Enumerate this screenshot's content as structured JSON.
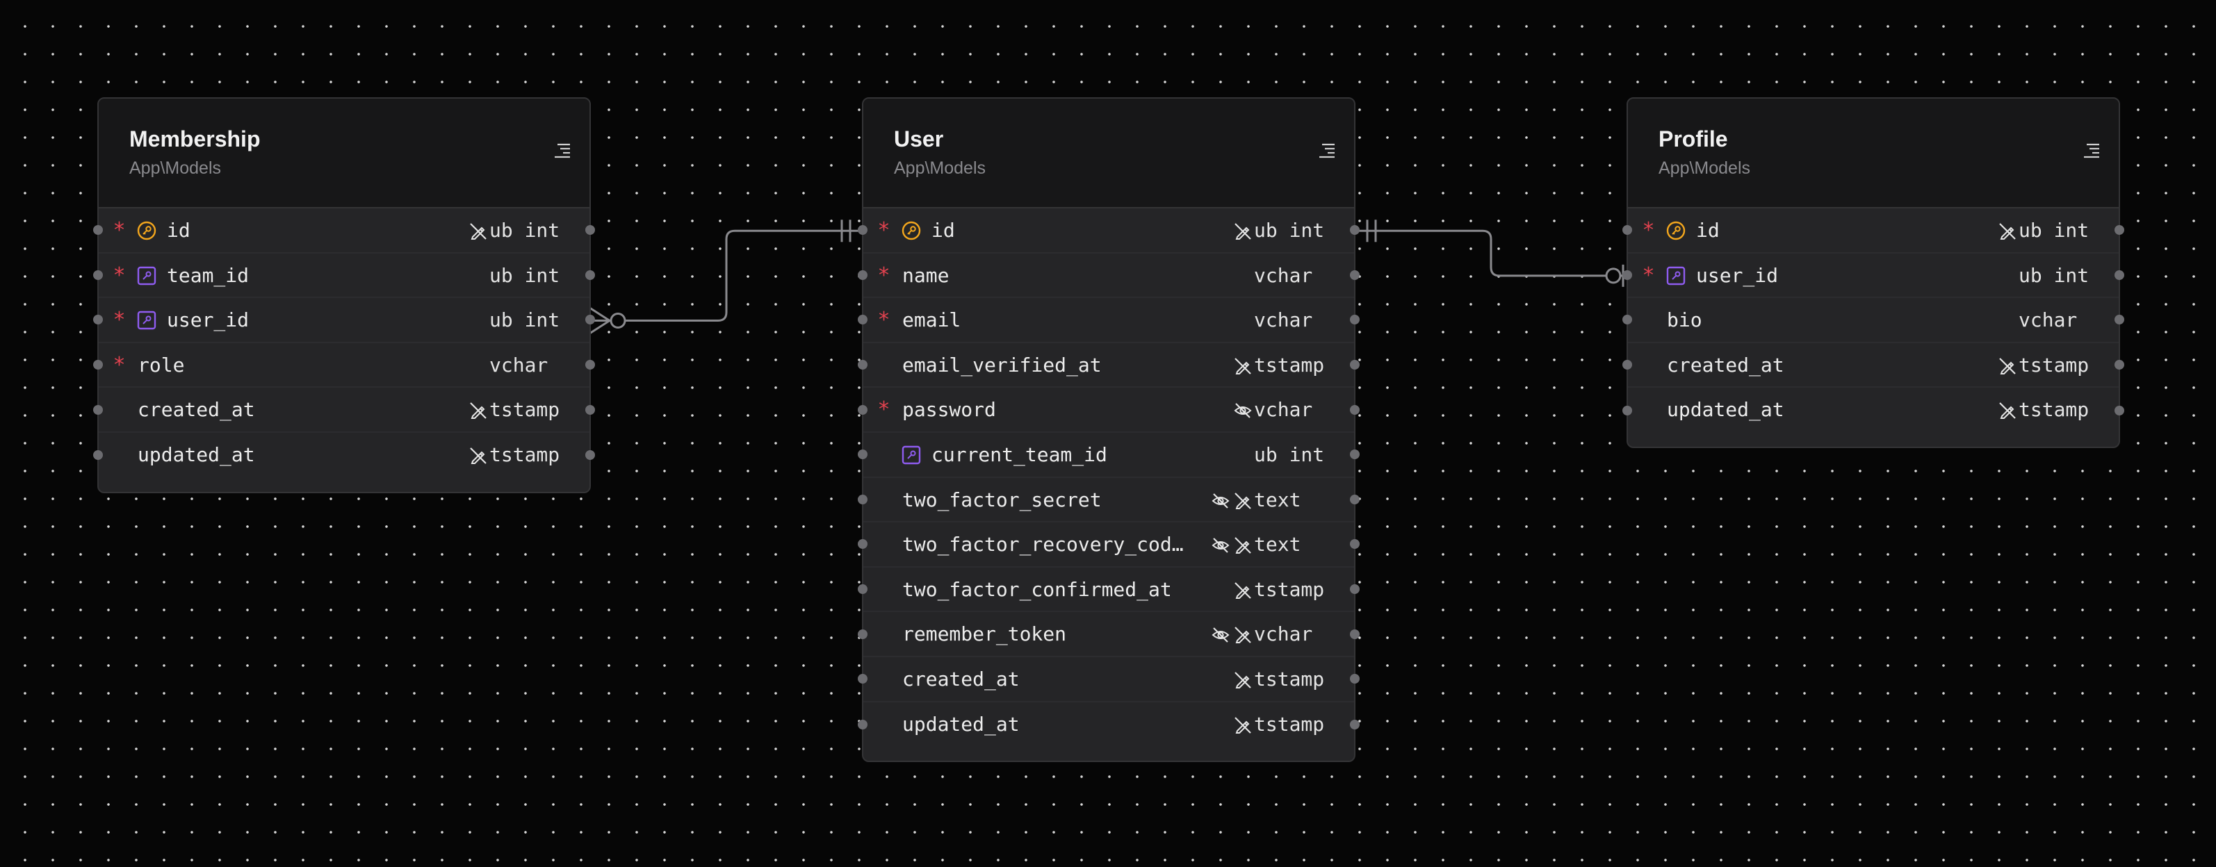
{
  "diagram": {
    "tables": [
      {
        "id": "membership",
        "name": "Membership",
        "namespace": "App\\Models",
        "columns": [
          {
            "name": "id",
            "type": "ub int",
            "required": true,
            "icon": "primary-key-icon",
            "flags": [
              "no-edit-icon"
            ]
          },
          {
            "name": "team_id",
            "type": "ub int",
            "required": true,
            "icon": "foreign-key-icon",
            "flags": []
          },
          {
            "name": "user_id",
            "type": "ub int",
            "required": true,
            "icon": "foreign-key-icon",
            "flags": []
          },
          {
            "name": "role",
            "type": "vchar",
            "required": true,
            "icon": null,
            "flags": []
          },
          {
            "name": "created_at",
            "type": "tstamp",
            "required": false,
            "icon": null,
            "flags": [
              "no-edit-icon"
            ]
          },
          {
            "name": "updated_at",
            "type": "tstamp",
            "required": false,
            "icon": null,
            "flags": [
              "no-edit-icon"
            ]
          }
        ]
      },
      {
        "id": "user",
        "name": "User",
        "namespace": "App\\Models",
        "columns": [
          {
            "name": "id",
            "type": "ub int",
            "required": true,
            "icon": "primary-key-icon",
            "flags": [
              "no-edit-icon"
            ]
          },
          {
            "name": "name",
            "type": "vchar",
            "required": true,
            "icon": null,
            "flags": []
          },
          {
            "name": "email",
            "type": "vchar",
            "required": true,
            "icon": null,
            "flags": []
          },
          {
            "name": "email_verified_at",
            "type": "tstamp",
            "required": false,
            "icon": null,
            "flags": [
              "no-edit-icon"
            ]
          },
          {
            "name": "password",
            "type": "vchar",
            "required": true,
            "icon": null,
            "flags": [
              "hidden-icon"
            ]
          },
          {
            "name": "current_team_id",
            "type": "ub int",
            "required": false,
            "icon": "foreign-key-icon",
            "flags": []
          },
          {
            "name": "two_factor_secret",
            "type": "text",
            "required": false,
            "icon": null,
            "flags": [
              "hidden-icon",
              "no-edit-icon"
            ]
          },
          {
            "name": "two_factor_recovery_cod…",
            "type": "text",
            "required": false,
            "icon": null,
            "flags": [
              "hidden-icon",
              "no-edit-icon"
            ]
          },
          {
            "name": "two_factor_confirmed_at",
            "type": "tstamp",
            "required": false,
            "icon": null,
            "flags": [
              "no-edit-icon"
            ]
          },
          {
            "name": "remember_token",
            "type": "vchar",
            "required": false,
            "icon": null,
            "flags": [
              "hidden-icon",
              "no-edit-icon"
            ]
          },
          {
            "name": "created_at",
            "type": "tstamp",
            "required": false,
            "icon": null,
            "flags": [
              "no-edit-icon"
            ]
          },
          {
            "name": "updated_at",
            "type": "tstamp",
            "required": false,
            "icon": null,
            "flags": [
              "no-edit-icon"
            ]
          }
        ]
      },
      {
        "id": "profile",
        "name": "Profile",
        "namespace": "App\\Models",
        "columns": [
          {
            "name": "id",
            "type": "ub int",
            "required": true,
            "icon": "primary-key-icon",
            "flags": [
              "no-edit-icon"
            ]
          },
          {
            "name": "user_id",
            "type": "ub int",
            "required": true,
            "icon": "foreign-key-icon",
            "flags": []
          },
          {
            "name": "bio",
            "type": "vchar",
            "required": false,
            "icon": null,
            "flags": []
          },
          {
            "name": "created_at",
            "type": "tstamp",
            "required": false,
            "icon": null,
            "flags": [
              "no-edit-icon"
            ]
          },
          {
            "name": "updated_at",
            "type": "tstamp",
            "required": false,
            "icon": null,
            "flags": [
              "no-edit-icon"
            ]
          }
        ]
      }
    ],
    "relations": [
      {
        "from_table": "membership",
        "from_column": "user_id",
        "from_cardinality": "zero-or-many",
        "to_table": "user",
        "to_column": "id",
        "to_cardinality": "exactly-one"
      },
      {
        "from_table": "user",
        "from_column": "id",
        "from_cardinality": "exactly-one",
        "to_table": "profile",
        "to_column": "user_id",
        "to_cardinality": "zero-or-one"
      }
    ]
  },
  "colors": {
    "background": "#060606",
    "node": "#252527",
    "header": "#171718",
    "required": "#e2424f",
    "primary_key": "#f4a71d",
    "foreign_key": "#8f5cf0",
    "edge": "#8a8a8e",
    "handle": "#6c6c70"
  },
  "symbols": {
    "required": "*"
  }
}
